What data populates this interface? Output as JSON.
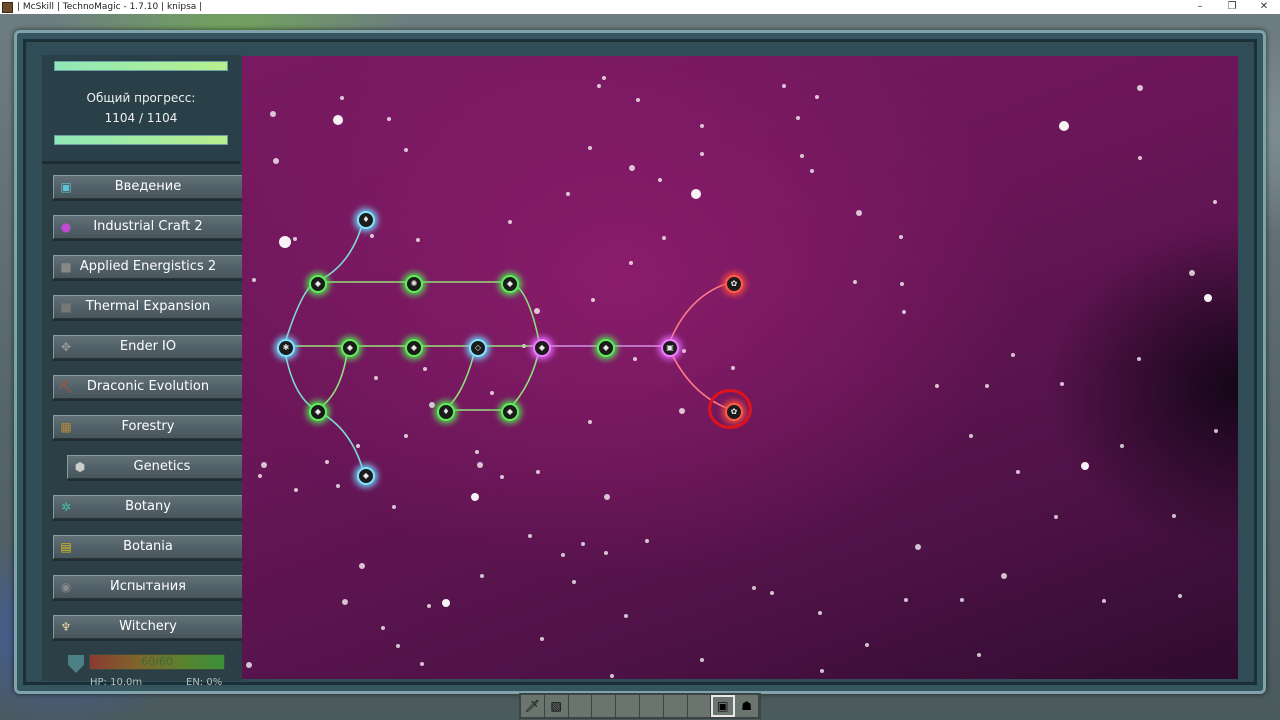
{
  "window": {
    "title": "| McSkill | TechnoMagic - 1.7.10 | knipsa |",
    "controls": [
      "–",
      "❐",
      "✕"
    ]
  },
  "progress": {
    "label": "Общий прогресс:",
    "value": "1104 / 1104",
    "fraction": 1.0
  },
  "categories": [
    {
      "label": "Введение",
      "icon": "book-icon",
      "glyph": "▣",
      "color": "#5fc3d9"
    },
    {
      "label": "Industrial Craft 2",
      "icon": "rubber-blob-icon",
      "glyph": "●",
      "color": "#c04ad0"
    },
    {
      "label": "Applied Energistics 2",
      "icon": "me-block-icon",
      "glyph": "■",
      "color": "#888888"
    },
    {
      "label": "Thermal Expansion",
      "icon": "machine-block-icon",
      "glyph": "■",
      "color": "#777777"
    },
    {
      "label": "Ender IO",
      "icon": "conduit-icon",
      "glyph": "✥",
      "color": "#999999"
    },
    {
      "label": "Draconic Evolution",
      "icon": "pickaxe-icon",
      "glyph": "⛏",
      "color": "#c8501e"
    },
    {
      "label": "Forestry",
      "icon": "crate-icon",
      "glyph": "▦",
      "color": "#b08a3a"
    },
    {
      "label": "Genetics",
      "icon": "analyser-icon",
      "glyph": "⬢",
      "color": "#cccccc"
    },
    {
      "label": "Botany",
      "icon": "plant-icon",
      "glyph": "✲",
      "color": "#3fc0a0"
    },
    {
      "label": "Botania",
      "icon": "lexicon-icon",
      "glyph": "▤",
      "color": "#d8c020"
    },
    {
      "label": "Испытания",
      "icon": "orb-icon",
      "glyph": "◉",
      "color": "#8a8a8a"
    },
    {
      "label": "Witchery",
      "icon": "candles-icon",
      "glyph": "♆",
      "color": "#e8d8a0"
    }
  ],
  "status": {
    "health": "60/60",
    "hp_label": "HP: 10.0m",
    "en_label": "EN: 0%"
  },
  "research_tree": {
    "nodes": [
      {
        "id": "n1",
        "color": "cyan",
        "icon": "potion-icon",
        "glyph": "♦"
      },
      {
        "id": "n2",
        "color": "green",
        "icon": "block-icon",
        "glyph": "◆"
      },
      {
        "id": "n3",
        "color": "green",
        "icon": "ore-icon",
        "glyph": "✺"
      },
      {
        "id": "n4",
        "color": "green",
        "icon": "block-icon",
        "glyph": "◆"
      },
      {
        "id": "n5",
        "color": "cyan",
        "icon": "root-icon",
        "glyph": "✱"
      },
      {
        "id": "n6",
        "color": "green",
        "icon": "block-icon",
        "glyph": "◆"
      },
      {
        "id": "n7",
        "color": "green",
        "icon": "block-icon",
        "glyph": "◆"
      },
      {
        "id": "n8",
        "color": "cyan",
        "icon": "crystal-icon",
        "glyph": "◇"
      },
      {
        "id": "n9",
        "color": "purple",
        "icon": "block-icon",
        "glyph": "◆"
      },
      {
        "id": "n10",
        "color": "green",
        "icon": "block-icon",
        "glyph": "◆"
      },
      {
        "id": "n11",
        "color": "purple",
        "icon": "terminal-icon",
        "glyph": "▣"
      },
      {
        "id": "n12",
        "color": "red",
        "icon": "bee-icon",
        "glyph": "✿"
      },
      {
        "id": "n13",
        "color": "red",
        "icon": "bee-icon",
        "glyph": "✿"
      },
      {
        "id": "n14",
        "color": "green",
        "icon": "block-icon",
        "glyph": "◆"
      },
      {
        "id": "n15",
        "color": "green",
        "icon": "potion-icon",
        "glyph": "♦"
      },
      {
        "id": "n16",
        "color": "green",
        "icon": "block-icon",
        "glyph": "◆"
      },
      {
        "id": "n17",
        "color": "cyan",
        "icon": "block-icon",
        "glyph": "◆"
      }
    ],
    "highlighted_node": "n13"
  },
  "hotbar": {
    "slots": [
      "🗡",
      "▧",
      "",
      "",
      "",
      "",
      "",
      "",
      "▣",
      "☗"
    ],
    "selected_index": 8
  }
}
